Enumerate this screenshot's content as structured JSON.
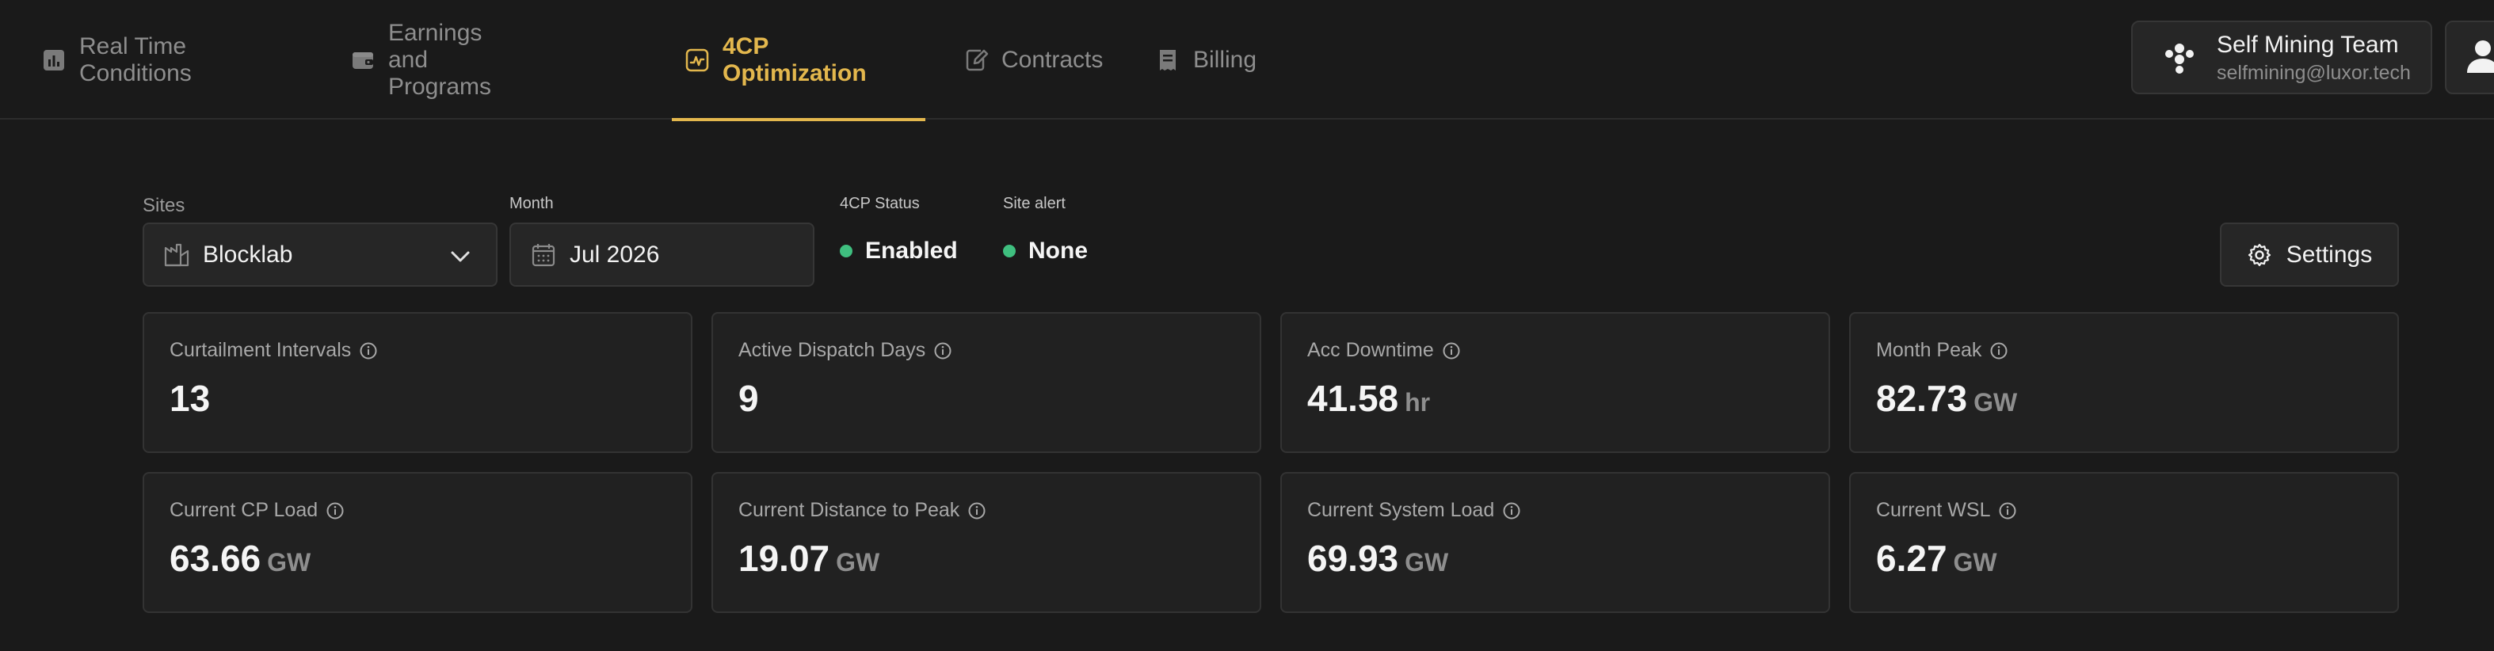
{
  "nav": {
    "tabs": [
      {
        "label": "Real Time Conditions",
        "icon": "bar-chart-icon"
      },
      {
        "label": "Earnings and Programs",
        "icon": "wallet-icon"
      },
      {
        "label": "4CP Optimization",
        "icon": "pulse-chart-icon",
        "active": true
      },
      {
        "label": "Contracts",
        "icon": "document-edit-icon"
      },
      {
        "label": "Billing",
        "icon": "receipt-icon"
      }
    ],
    "accent": "#e3b74d"
  },
  "account": {
    "team_name": "Self Mining Team",
    "email": "selfmining@luxor.tech"
  },
  "filters": {
    "sites_label": "Sites",
    "sites_value": "Blocklab",
    "month_label": "Month",
    "month_value": "Jul 2026",
    "status_label": "4CP Status",
    "status_value": "Enabled",
    "alert_label": "Site alert",
    "alert_value": "None",
    "status_color": "#3fbf7f"
  },
  "settings_label": "Settings",
  "metrics": [
    {
      "title": "Curtailment Intervals",
      "value": "13",
      "unit": ""
    },
    {
      "title": "Active Dispatch Days",
      "value": "9",
      "unit": ""
    },
    {
      "title": "Acc Downtime",
      "value": "41.58",
      "unit": "hr"
    },
    {
      "title": "Month Peak",
      "value": "82.73",
      "unit": "GW"
    },
    {
      "title": "Current CP Load",
      "value": "63.66",
      "unit": "GW"
    },
    {
      "title": "Current Distance to Peak",
      "value": "19.07",
      "unit": "GW"
    },
    {
      "title": "Current System Load",
      "value": "69.93",
      "unit": "GW"
    },
    {
      "title": "Current WSL",
      "value": "6.27",
      "unit": "GW"
    }
  ]
}
